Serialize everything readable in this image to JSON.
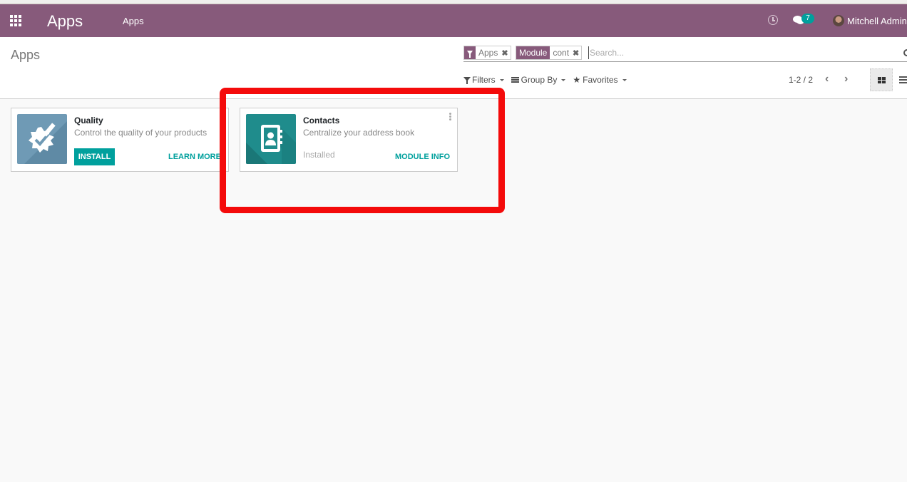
{
  "navbar": {
    "brand": "Apps",
    "menu_item": "Apps",
    "chat_badge_count": "7",
    "user_name": "Mitchell Admin",
    "colors": {
      "primary": "#875a7b",
      "badge": "#00a09d"
    }
  },
  "control_panel": {
    "breadcrumb": "Apps",
    "search": {
      "facets": [
        {
          "type": "filter",
          "icon": "filter-icon",
          "values": "Apps"
        },
        {
          "type": "field",
          "label": "Module",
          "values": "cont"
        }
      ],
      "placeholder": "Search..."
    },
    "filters_label": "Filters",
    "groupby_label": "Group By",
    "favorites_label": "Favorites",
    "pager": "1-2 / 2",
    "views": [
      "kanban",
      "list"
    ],
    "active_view": "kanban"
  },
  "apps": [
    {
      "name": "Quality",
      "summary": "Control the quality of your products",
      "icon": "quality-badge-icon",
      "icon_color": "#6f9ab5",
      "install_label": "INSTALL",
      "link_label": "LEARN MORE",
      "installed": false
    },
    {
      "name": "Contacts",
      "summary": "Centralize your address book",
      "icon": "address-book-icon",
      "icon_color": "#1f8c8c",
      "status_label": "Installed",
      "link_label": "MODULE INFO",
      "installed": true
    }
  ],
  "annotation": {
    "color": "#f40b0b",
    "target": "Contacts card"
  }
}
